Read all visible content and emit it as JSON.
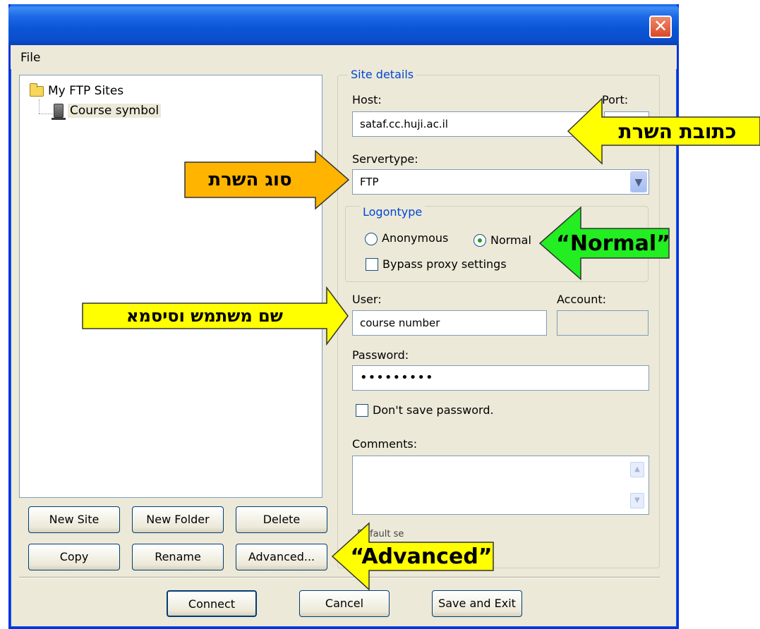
{
  "window": {
    "close_glyph": "✕"
  },
  "menu": {
    "file": "File"
  },
  "tree": {
    "root": "My FTP Sites",
    "child": "Course symbol"
  },
  "buttons": {
    "new_site": "New Site",
    "new_folder": "New Folder",
    "delete": "Delete",
    "copy": "Copy",
    "rename": "Rename",
    "advanced": "Advanced...",
    "connect": "Connect",
    "cancel": "Cancel",
    "save_exit": "Save and Exit"
  },
  "site_details": {
    "title": "Site details",
    "host_label": "Host:",
    "host_value": "sataf.cc.huji.ac.il",
    "port_label": "Port:",
    "servertype_label": "Servertype:",
    "servertype_value": "FTP",
    "logontype_title": "Logontype",
    "anonymous": "Anonymous",
    "normal": "Normal",
    "bypass": "Bypass proxy settings",
    "user_label": "User:",
    "user_value": "course number",
    "account_label": "Account:",
    "password_label": "Password:",
    "password_value": "•••••••••",
    "dont_save": "Don't save password.",
    "comments_label": "Comments:",
    "default_label": "Default se"
  },
  "callouts": {
    "host": "כתובת השרת",
    "servertype": "סוג השרת",
    "normal": "“Normal”",
    "user": "שם משתמש וסיסמא",
    "advanced": "“Advanced”"
  },
  "colors": {
    "callout_yellow": "#ffff00",
    "callout_orange": "#ffb400",
    "callout_green": "#22ee22"
  },
  "icons": [
    "folder-icon",
    "server-icon",
    "close-icon",
    "chevron-down-icon",
    "scroll-up-icon",
    "scroll-down-icon"
  ]
}
